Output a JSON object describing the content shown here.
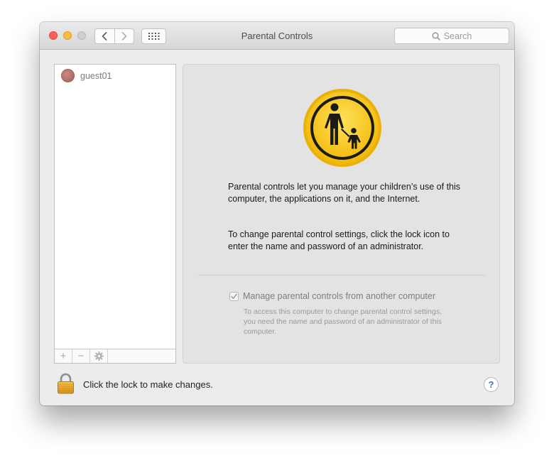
{
  "window": {
    "title": "Parental Controls"
  },
  "toolbar": {
    "back_icon": "chevron-left-icon",
    "forward_icon": "chevron-right-icon",
    "show_all_icon": "grid-icon",
    "search_placeholder": "Search",
    "search_icon": "magnifier-icon"
  },
  "users": [
    {
      "name": "guest01",
      "avatar": "avatar"
    }
  ],
  "list_toolbar": {
    "add_symbol": "+",
    "remove_symbol": "−",
    "gear_icon": "gear-icon"
  },
  "panel": {
    "badge_icon": "parent-child-icon",
    "intro_text": "Parental controls let you manage your children’s use of this computer, the applications on it, and the Internet.",
    "lock_instruction_text": "To change parental control settings, click the lock icon to enter the name and password of an administrator.",
    "remote_checkbox": {
      "label": "Manage parental controls from another computer",
      "checked": true,
      "enabled": false
    },
    "remote_description": "To access this computer to change parental control settings, you need the name and password of an administrator of this computer."
  },
  "footer": {
    "lock_icon": "lock-icon",
    "lock_text": "Click the lock to make changes.",
    "help_label": "?"
  },
  "colors": {
    "badge_yellow": "#f7c51b",
    "badge_ring": "#e0a800",
    "close": "#fc605b",
    "minimize": "#fdbc40",
    "zoom": "#d0d0d0",
    "help_blue": "#3f6fd7"
  }
}
